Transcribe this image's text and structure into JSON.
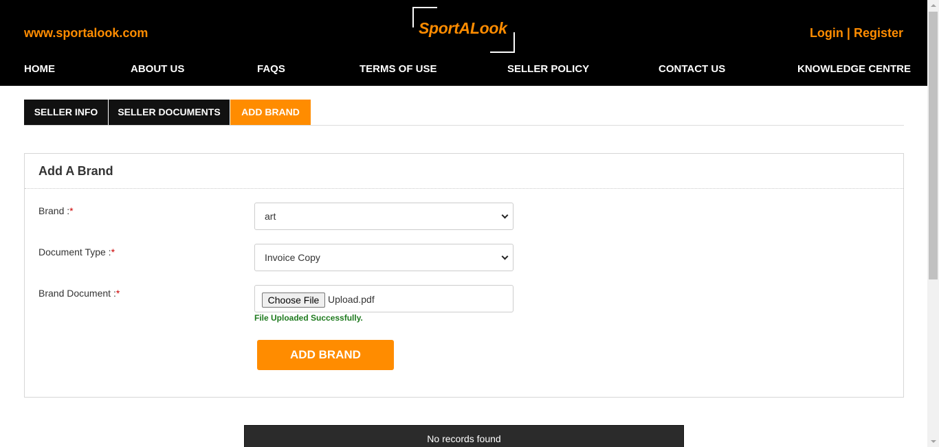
{
  "header": {
    "site_url": "www.sportalook.com",
    "logo_text": "SportALook",
    "login_label": "Login",
    "auth_separator": " | ",
    "register_label": "Register"
  },
  "nav": {
    "items": [
      {
        "label": "HOME"
      },
      {
        "label": "ABOUT US"
      },
      {
        "label": "FAQS"
      },
      {
        "label": "TERMS OF USE"
      },
      {
        "label": "SELLER POLICY"
      },
      {
        "label": "CONTACT US"
      },
      {
        "label": "KNOWLEDGE CENTRE"
      }
    ]
  },
  "tabs": [
    {
      "label": "SELLER INFO",
      "active": false
    },
    {
      "label": "SELLER DOCUMENTS",
      "active": false
    },
    {
      "label": "ADD BRAND",
      "active": true
    }
  ],
  "form": {
    "title": "Add A Brand",
    "brand_label": "Brand :",
    "brand_value": "art",
    "doc_type_label": "Document Type :",
    "doc_type_value": "Invoice Copy",
    "brand_doc_label": "Brand Document :",
    "required_mark": "*",
    "choose_file_label": "Choose File",
    "file_name": "Upload.pdf",
    "upload_status": "File Uploaded Successfully.",
    "submit_label": "ADD BRAND"
  },
  "records": {
    "empty_message": "No records found"
  },
  "colors": {
    "accent": "#ff8c00",
    "header_bg": "#000000",
    "success": "#1e7a1e"
  }
}
